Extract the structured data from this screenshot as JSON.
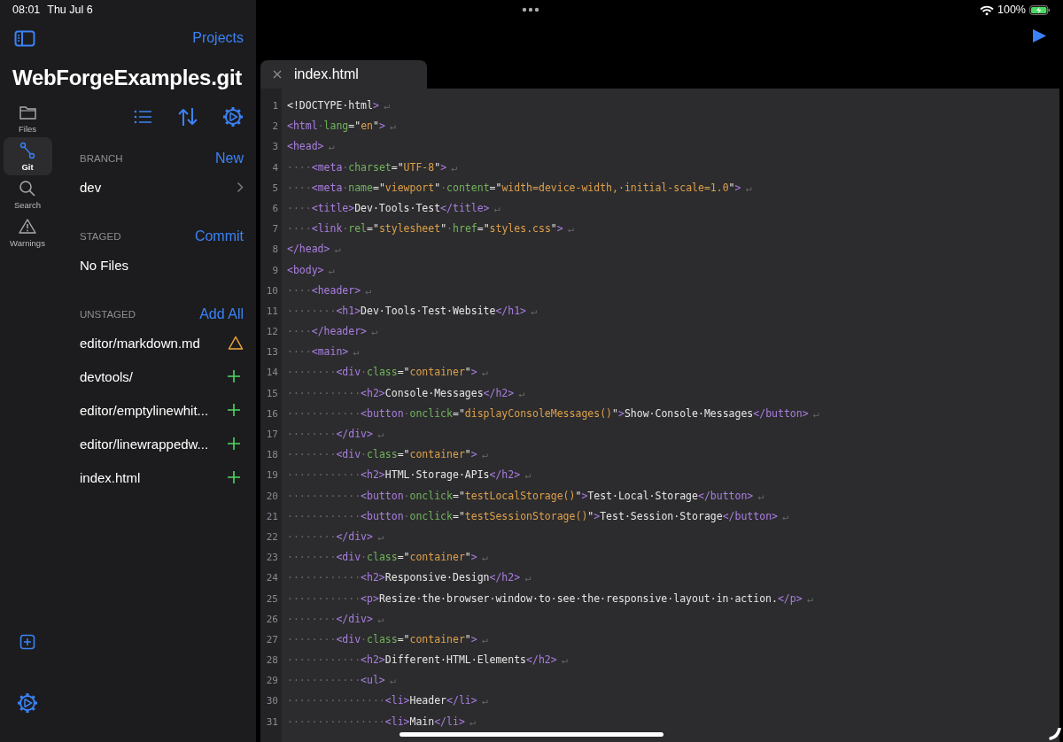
{
  "status_bar": {
    "time": "08:01",
    "date": "Thu Jul 6",
    "battery": "100%"
  },
  "sidebar": {
    "projects_link": "Projects",
    "title": "WebForgeExamples.git",
    "rail": [
      {
        "label": "Files",
        "selected": false
      },
      {
        "label": "Git",
        "selected": true
      },
      {
        "label": "Search",
        "selected": false
      },
      {
        "label": "Warnings",
        "selected": false
      }
    ],
    "sections": [
      {
        "heading": "BRANCH",
        "action": "New",
        "items": [
          {
            "kind": "branch",
            "name": "dev"
          }
        ]
      },
      {
        "heading": "STAGED",
        "action": "Commit",
        "items": [
          {
            "kind": "empty",
            "name": "No Files"
          }
        ]
      },
      {
        "heading": "UNSTAGED",
        "action": "Add All",
        "items": [
          {
            "kind": "file",
            "name": "editor/markdown.md",
            "warning": true
          },
          {
            "kind": "file",
            "name": "devtools/",
            "warning": false
          },
          {
            "kind": "file",
            "name": "editor/emptylinewhit...",
            "warning": false
          },
          {
            "kind": "file",
            "name": "editor/linewrappedw...",
            "warning": false
          },
          {
            "kind": "file",
            "name": "index.html",
            "warning": false
          }
        ]
      }
    ]
  },
  "editor": {
    "tabs": [
      {
        "label": "index.html",
        "selected": true
      }
    ],
    "lines": [
      {
        "number": "1",
        "tokens": [
          {
            "kind": "text",
            "text": "<!DOCTYPE·html"
          },
          {
            "kind": "tag",
            "text": ">"
          },
          {
            "kind": "eol",
            "text": "↵"
          }
        ]
      },
      {
        "number": "2",
        "tokens": [
          {
            "kind": "tag",
            "text": "<html"
          },
          {
            "kind": "ws",
            "text": "·"
          },
          {
            "kind": "attr",
            "text": "lang"
          },
          {
            "kind": "punct",
            "text": "=\""
          },
          {
            "kind": "str",
            "text": "en"
          },
          {
            "kind": "punct",
            "text": "\""
          },
          {
            "kind": "tag",
            "text": ">"
          },
          {
            "kind": "eol",
            "text": "↵"
          }
        ]
      },
      {
        "number": "3",
        "tokens": [
          {
            "kind": "tag",
            "text": "<head>"
          },
          {
            "kind": "eol",
            "text": "↵"
          }
        ]
      },
      {
        "number": "4",
        "tokens": [
          {
            "kind": "ws",
            "text": "····"
          },
          {
            "kind": "tag",
            "text": "<meta"
          },
          {
            "kind": "ws",
            "text": "·"
          },
          {
            "kind": "attr",
            "text": "charset"
          },
          {
            "kind": "punct",
            "text": "=\""
          },
          {
            "kind": "str",
            "text": "UTF-8"
          },
          {
            "kind": "punct",
            "text": "\""
          },
          {
            "kind": "tag",
            "text": ">"
          },
          {
            "kind": "eol",
            "text": "↵"
          }
        ]
      },
      {
        "number": "5",
        "tokens": [
          {
            "kind": "ws",
            "text": "····"
          },
          {
            "kind": "tag",
            "text": "<meta"
          },
          {
            "kind": "ws",
            "text": "·"
          },
          {
            "kind": "attr",
            "text": "name"
          },
          {
            "kind": "punct",
            "text": "=\""
          },
          {
            "kind": "str",
            "text": "viewport"
          },
          {
            "kind": "punct",
            "text": "\""
          },
          {
            "kind": "ws",
            "text": "·"
          },
          {
            "kind": "attr",
            "text": "content"
          },
          {
            "kind": "punct",
            "text": "=\""
          },
          {
            "kind": "str",
            "text": "width=device-width,·initial-scale=1.0"
          },
          {
            "kind": "punct",
            "text": "\""
          },
          {
            "kind": "tag",
            "text": ">"
          },
          {
            "kind": "eol",
            "text": "↵"
          }
        ]
      },
      {
        "number": "6",
        "tokens": [
          {
            "kind": "ws",
            "text": "····"
          },
          {
            "kind": "tag",
            "text": "<title>"
          },
          {
            "kind": "text",
            "text": "Dev·Tools·Test"
          },
          {
            "kind": "tag",
            "text": "</title>"
          },
          {
            "kind": "eol",
            "text": "↵"
          }
        ]
      },
      {
        "number": "7",
        "tokens": [
          {
            "kind": "ws",
            "text": "····"
          },
          {
            "kind": "tag",
            "text": "<link"
          },
          {
            "kind": "ws",
            "text": "·"
          },
          {
            "kind": "attr",
            "text": "rel"
          },
          {
            "kind": "punct",
            "text": "=\""
          },
          {
            "kind": "str",
            "text": "stylesheet"
          },
          {
            "kind": "punct",
            "text": "\""
          },
          {
            "kind": "ws",
            "text": "·"
          },
          {
            "kind": "attr",
            "text": "href"
          },
          {
            "kind": "punct",
            "text": "=\""
          },
          {
            "kind": "str",
            "text": "styles.css"
          },
          {
            "kind": "punct",
            "text": "\""
          },
          {
            "kind": "tag",
            "text": ">"
          },
          {
            "kind": "eol",
            "text": "↵"
          }
        ]
      },
      {
        "number": "8",
        "tokens": [
          {
            "kind": "tag",
            "text": "</head>"
          },
          {
            "kind": "eol",
            "text": "↵"
          }
        ]
      },
      {
        "number": "9",
        "tokens": [
          {
            "kind": "tag",
            "text": "<body>"
          },
          {
            "kind": "eol",
            "text": "↵"
          }
        ]
      },
      {
        "number": "10",
        "tokens": [
          {
            "kind": "ws",
            "text": "····"
          },
          {
            "kind": "tag",
            "text": "<header>"
          },
          {
            "kind": "eol",
            "text": "↵"
          }
        ]
      },
      {
        "number": "11",
        "tokens": [
          {
            "kind": "ws",
            "text": "········"
          },
          {
            "kind": "tag",
            "text": "<h1>"
          },
          {
            "kind": "text",
            "text": "Dev·Tools·Test·Website"
          },
          {
            "kind": "tag",
            "text": "</h1>"
          },
          {
            "kind": "eol",
            "text": "↵"
          }
        ]
      },
      {
        "number": "12",
        "tokens": [
          {
            "kind": "ws",
            "text": "····"
          },
          {
            "kind": "tag",
            "text": "</header>"
          },
          {
            "kind": "eol",
            "text": "↵"
          }
        ]
      },
      {
        "number": "13",
        "tokens": [
          {
            "kind": "ws",
            "text": "····"
          },
          {
            "kind": "tag",
            "text": "<main>"
          },
          {
            "kind": "eol",
            "text": "↵"
          }
        ]
      },
      {
        "number": "14",
        "tokens": [
          {
            "kind": "ws",
            "text": "········"
          },
          {
            "kind": "tag",
            "text": "<div"
          },
          {
            "kind": "ws",
            "text": "·"
          },
          {
            "kind": "attr",
            "text": "class"
          },
          {
            "kind": "punct",
            "text": "=\""
          },
          {
            "kind": "str",
            "text": "container"
          },
          {
            "kind": "punct",
            "text": "\""
          },
          {
            "kind": "tag",
            "text": ">"
          },
          {
            "kind": "eol",
            "text": "↵"
          }
        ]
      },
      {
        "number": "15",
        "tokens": [
          {
            "kind": "ws",
            "text": "············"
          },
          {
            "kind": "tag",
            "text": "<h2>"
          },
          {
            "kind": "text",
            "text": "Console·Messages"
          },
          {
            "kind": "tag",
            "text": "</h2>"
          },
          {
            "kind": "eol",
            "text": "↵"
          }
        ]
      },
      {
        "number": "16",
        "tokens": [
          {
            "kind": "ws",
            "text": "············"
          },
          {
            "kind": "tag",
            "text": "<button"
          },
          {
            "kind": "ws",
            "text": "·"
          },
          {
            "kind": "attr",
            "text": "onclick"
          },
          {
            "kind": "punct",
            "text": "=\""
          },
          {
            "kind": "str",
            "text": "displayConsoleMessages()"
          },
          {
            "kind": "punct",
            "text": "\""
          },
          {
            "kind": "tag",
            "text": ">"
          },
          {
            "kind": "text",
            "text": "Show·Console·Messages"
          },
          {
            "kind": "tag",
            "text": "</button>"
          },
          {
            "kind": "eol",
            "text": "↵"
          }
        ]
      },
      {
        "number": "17",
        "tokens": [
          {
            "kind": "ws",
            "text": "········"
          },
          {
            "kind": "tag",
            "text": "</div>"
          },
          {
            "kind": "eol",
            "text": "↵"
          }
        ]
      },
      {
        "number": "18",
        "tokens": [
          {
            "kind": "ws",
            "text": "········"
          },
          {
            "kind": "tag",
            "text": "<div"
          },
          {
            "kind": "ws",
            "text": "·"
          },
          {
            "kind": "attr",
            "text": "class"
          },
          {
            "kind": "punct",
            "text": "=\""
          },
          {
            "kind": "str",
            "text": "container"
          },
          {
            "kind": "punct",
            "text": "\""
          },
          {
            "kind": "tag",
            "text": ">"
          },
          {
            "kind": "eol",
            "text": "↵"
          }
        ]
      },
      {
        "number": "19",
        "tokens": [
          {
            "kind": "ws",
            "text": "············"
          },
          {
            "kind": "tag",
            "text": "<h2>"
          },
          {
            "kind": "text",
            "text": "HTML·Storage·APIs"
          },
          {
            "kind": "tag",
            "text": "</h2>"
          },
          {
            "kind": "eol",
            "text": "↵"
          }
        ]
      },
      {
        "number": "20",
        "tokens": [
          {
            "kind": "ws",
            "text": "············"
          },
          {
            "kind": "tag",
            "text": "<button"
          },
          {
            "kind": "ws",
            "text": "·"
          },
          {
            "kind": "attr",
            "text": "onclick"
          },
          {
            "kind": "punct",
            "text": "=\""
          },
          {
            "kind": "str",
            "text": "testLocalStorage()"
          },
          {
            "kind": "punct",
            "text": "\""
          },
          {
            "kind": "tag",
            "text": ">"
          },
          {
            "kind": "text",
            "text": "Test·Local·Storage"
          },
          {
            "kind": "tag",
            "text": "</button>"
          },
          {
            "kind": "eol",
            "text": "↵"
          }
        ]
      },
      {
        "number": "21",
        "tokens": [
          {
            "kind": "ws",
            "text": "············"
          },
          {
            "kind": "tag",
            "text": "<button"
          },
          {
            "kind": "ws",
            "text": "·"
          },
          {
            "kind": "attr",
            "text": "onclick"
          },
          {
            "kind": "punct",
            "text": "=\""
          },
          {
            "kind": "str",
            "text": "testSessionStorage()"
          },
          {
            "kind": "punct",
            "text": "\""
          },
          {
            "kind": "tag",
            "text": ">"
          },
          {
            "kind": "text",
            "text": "Test·Session·Storage"
          },
          {
            "kind": "tag",
            "text": "</button>"
          },
          {
            "kind": "eol",
            "text": "↵"
          }
        ]
      },
      {
        "number": "22",
        "tokens": [
          {
            "kind": "ws",
            "text": "········"
          },
          {
            "kind": "tag",
            "text": "</div>"
          },
          {
            "kind": "eol",
            "text": "↵"
          }
        ]
      },
      {
        "number": "23",
        "tokens": [
          {
            "kind": "ws",
            "text": "········"
          },
          {
            "kind": "tag",
            "text": "<div"
          },
          {
            "kind": "ws",
            "text": "·"
          },
          {
            "kind": "attr",
            "text": "class"
          },
          {
            "kind": "punct",
            "text": "=\""
          },
          {
            "kind": "str",
            "text": "container"
          },
          {
            "kind": "punct",
            "text": "\""
          },
          {
            "kind": "tag",
            "text": ">"
          },
          {
            "kind": "eol",
            "text": "↵"
          }
        ]
      },
      {
        "number": "24",
        "tokens": [
          {
            "kind": "ws",
            "text": "············"
          },
          {
            "kind": "tag",
            "text": "<h2>"
          },
          {
            "kind": "text",
            "text": "Responsive·Design"
          },
          {
            "kind": "tag",
            "text": "</h2>"
          },
          {
            "kind": "eol",
            "text": "↵"
          }
        ]
      },
      {
        "number": "25",
        "tokens": [
          {
            "kind": "ws",
            "text": "············"
          },
          {
            "kind": "tag",
            "text": "<p>"
          },
          {
            "kind": "text",
            "text": "Resize·the·browser·window·to·see·the·responsive·layout·in·action."
          },
          {
            "kind": "tag",
            "text": "</p>"
          },
          {
            "kind": "eol",
            "text": "↵"
          }
        ]
      },
      {
        "number": "26",
        "tokens": [
          {
            "kind": "ws",
            "text": "········"
          },
          {
            "kind": "tag",
            "text": "</div>"
          },
          {
            "kind": "eol",
            "text": "↵"
          }
        ]
      },
      {
        "number": "27",
        "tokens": [
          {
            "kind": "ws",
            "text": "········"
          },
          {
            "kind": "tag",
            "text": "<div"
          },
          {
            "kind": "ws",
            "text": "·"
          },
          {
            "kind": "attr",
            "text": "class"
          },
          {
            "kind": "punct",
            "text": "=\""
          },
          {
            "kind": "str",
            "text": "container"
          },
          {
            "kind": "punct",
            "text": "\""
          },
          {
            "kind": "tag",
            "text": ">"
          },
          {
            "kind": "eol",
            "text": "↵"
          }
        ]
      },
      {
        "number": "28",
        "tokens": [
          {
            "kind": "ws",
            "text": "············"
          },
          {
            "kind": "tag",
            "text": "<h2>"
          },
          {
            "kind": "text",
            "text": "Different·HTML·Elements"
          },
          {
            "kind": "tag",
            "text": "</h2>"
          },
          {
            "kind": "eol",
            "text": "↵"
          }
        ]
      },
      {
        "number": "29",
        "tokens": [
          {
            "kind": "ws",
            "text": "············"
          },
          {
            "kind": "tag",
            "text": "<ul>"
          },
          {
            "kind": "eol",
            "text": "↵"
          }
        ]
      },
      {
        "number": "30",
        "tokens": [
          {
            "kind": "ws",
            "text": "················"
          },
          {
            "kind": "tag",
            "text": "<li>"
          },
          {
            "kind": "text",
            "text": "Header"
          },
          {
            "kind": "tag",
            "text": "</li>"
          },
          {
            "kind": "eol",
            "text": "↵"
          }
        ]
      },
      {
        "number": "31",
        "tokens": [
          {
            "kind": "ws",
            "text": "················"
          },
          {
            "kind": "tag",
            "text": "<li>"
          },
          {
            "kind": "text",
            "text": "Main"
          },
          {
            "kind": "tag",
            "text": "</li>"
          },
          {
            "kind": "eol",
            "text": "↵"
          }
        ]
      }
    ]
  }
}
